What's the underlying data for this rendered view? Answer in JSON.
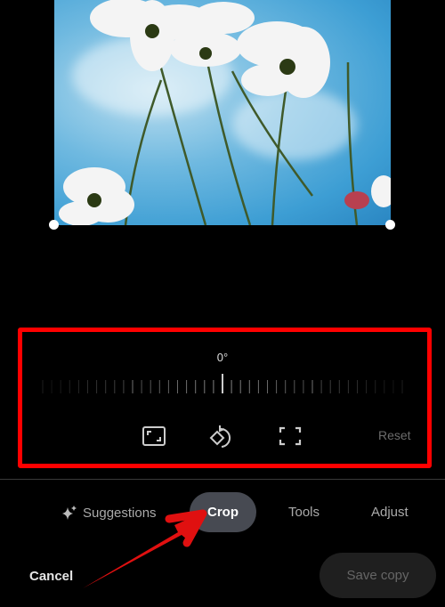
{
  "rotation": {
    "angle_label": "0°",
    "value_degrees": 0
  },
  "tools": [
    {
      "icon": "aspect-ratio-icon"
    },
    {
      "icon": "rotate-icon"
    },
    {
      "icon": "free-crop-icon"
    }
  ],
  "reset_label": "Reset",
  "tabs": [
    {
      "label": "Suggestions",
      "icon": "sparkle-icon"
    },
    {
      "label": "Crop",
      "selected": true
    },
    {
      "label": "Tools"
    },
    {
      "label": "Adjust"
    }
  ],
  "footer": {
    "cancel_label": "Cancel",
    "save_label": "Save copy"
  },
  "colors": {
    "highlight": "#ff0000",
    "selected_tab": "#474a52"
  }
}
